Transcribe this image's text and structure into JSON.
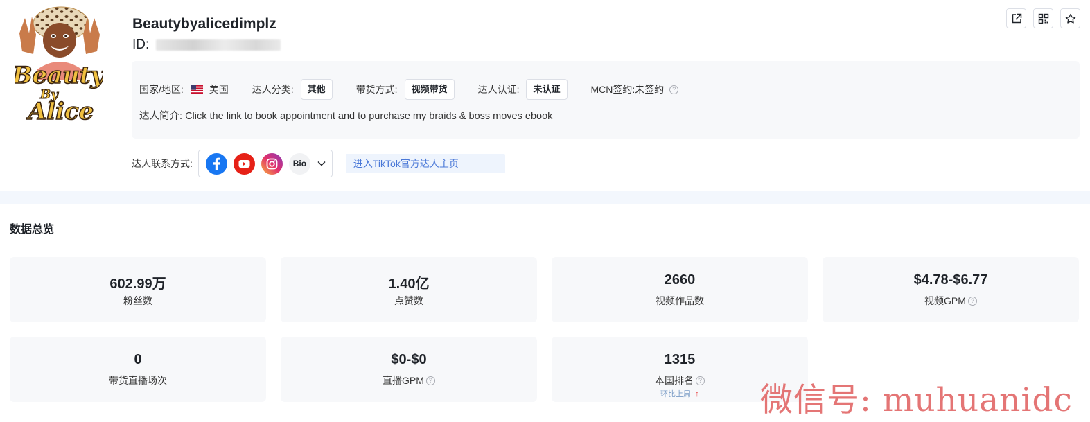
{
  "profile": {
    "name": "Beautybyalicedimplz",
    "id_label": "ID:",
    "country_label": "国家/地区:",
    "country_value": "美国",
    "category_label": "达人分类:",
    "category_value": "其他",
    "sales_mode_label": "带货方式:",
    "sales_mode_value": "视频带货",
    "verification_label": "达人认证:",
    "verification_value": "未认证",
    "mcn_label": "MCN签约:",
    "mcn_value": "未签约",
    "bio_label": "达人简介:",
    "bio_value": "Click the link to book appointment and to purchase my braids & boss moves ebook",
    "avatar_text_top": "Beauty",
    "avatar_text_mid": "By",
    "avatar_text_bottom": "Alice"
  },
  "contact": {
    "label": "达人联系方式:",
    "socials": [
      "facebook-icon",
      "youtube-icon",
      "instagram-icon"
    ],
    "bio_chip": "Bio",
    "tiktok_link": "进入TikTok官方达人主页"
  },
  "colors": {
    "facebook": "#1877f2",
    "youtube": "#e62117",
    "instagram": "#e1306c",
    "link": "#4a78d8",
    "card_bg": "#f7f8fa",
    "watermark": "#e26a6a"
  },
  "overview": {
    "title": "数据总览",
    "cards": [
      {
        "value": "602.99万",
        "label": "粉丝数"
      },
      {
        "value": "1.40亿",
        "label": "点赞数"
      },
      {
        "value": "2660",
        "label": "视频作品数"
      },
      {
        "value": "$4.78-$6.77",
        "label": "视频GPM"
      },
      {
        "value": "0",
        "label": "带货直播场次"
      },
      {
        "value": "$0-$0",
        "label": "直播GPM"
      },
      {
        "value": "1315",
        "label": "本国排名",
        "sub": "环比上周:"
      }
    ]
  },
  "watermark": "微信号: muhuanidc"
}
